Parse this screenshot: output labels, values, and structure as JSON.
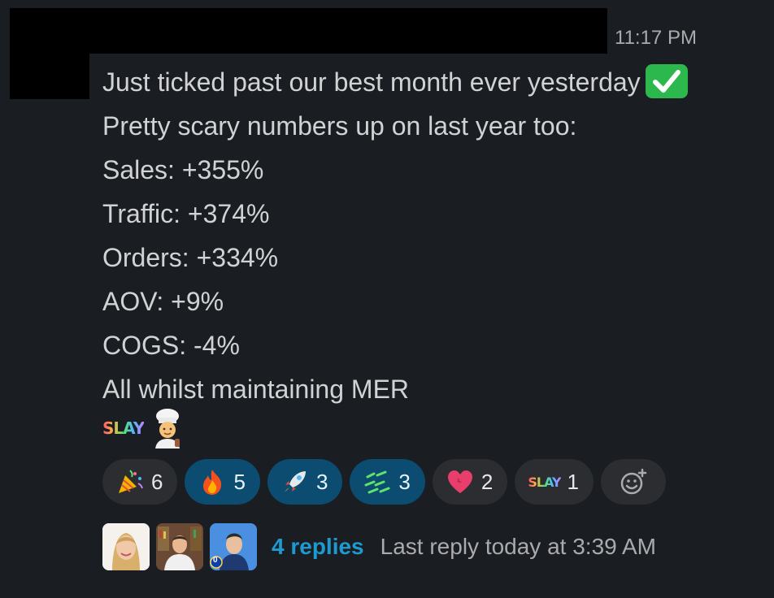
{
  "message": {
    "timestamp": "11:17 PM",
    "lines": [
      "Just ticked past our best month ever yesterday",
      "Pretty scary numbers up on last year too:",
      "Sales: +355%",
      "Traffic: +374%",
      "Orders: +334%",
      "AOV: +9%",
      "COGS: -4%",
      "All whilst maintaining MER"
    ],
    "inline_emoji": [
      "white-check-mark",
      "slay",
      "cook"
    ],
    "slay_text": "SLAY"
  },
  "reactions": [
    {
      "emoji": "party-popper",
      "count": "6",
      "active": false
    },
    {
      "emoji": "fire",
      "count": "5",
      "active": true
    },
    {
      "emoji": "rocket",
      "count": "3",
      "active": true
    },
    {
      "emoji": "money-rain",
      "count": "3",
      "active": true
    },
    {
      "emoji": "heart",
      "count": "2",
      "active": false
    },
    {
      "emoji": "slay",
      "count": "1",
      "active": false,
      "label": "SLAY"
    }
  ],
  "add_reaction": {
    "icon": "add-reaction-icon"
  },
  "thread": {
    "replies_label": "4 replies",
    "last_reply": "Last reply today at 3:39 AM",
    "avatar_badge": "0"
  },
  "colors": {
    "background": "#1a1d21",
    "text": "#d1d2d3",
    "link": "#1d9bd1",
    "active_reaction": "#0b4c70",
    "reaction": "#2b2d31"
  }
}
